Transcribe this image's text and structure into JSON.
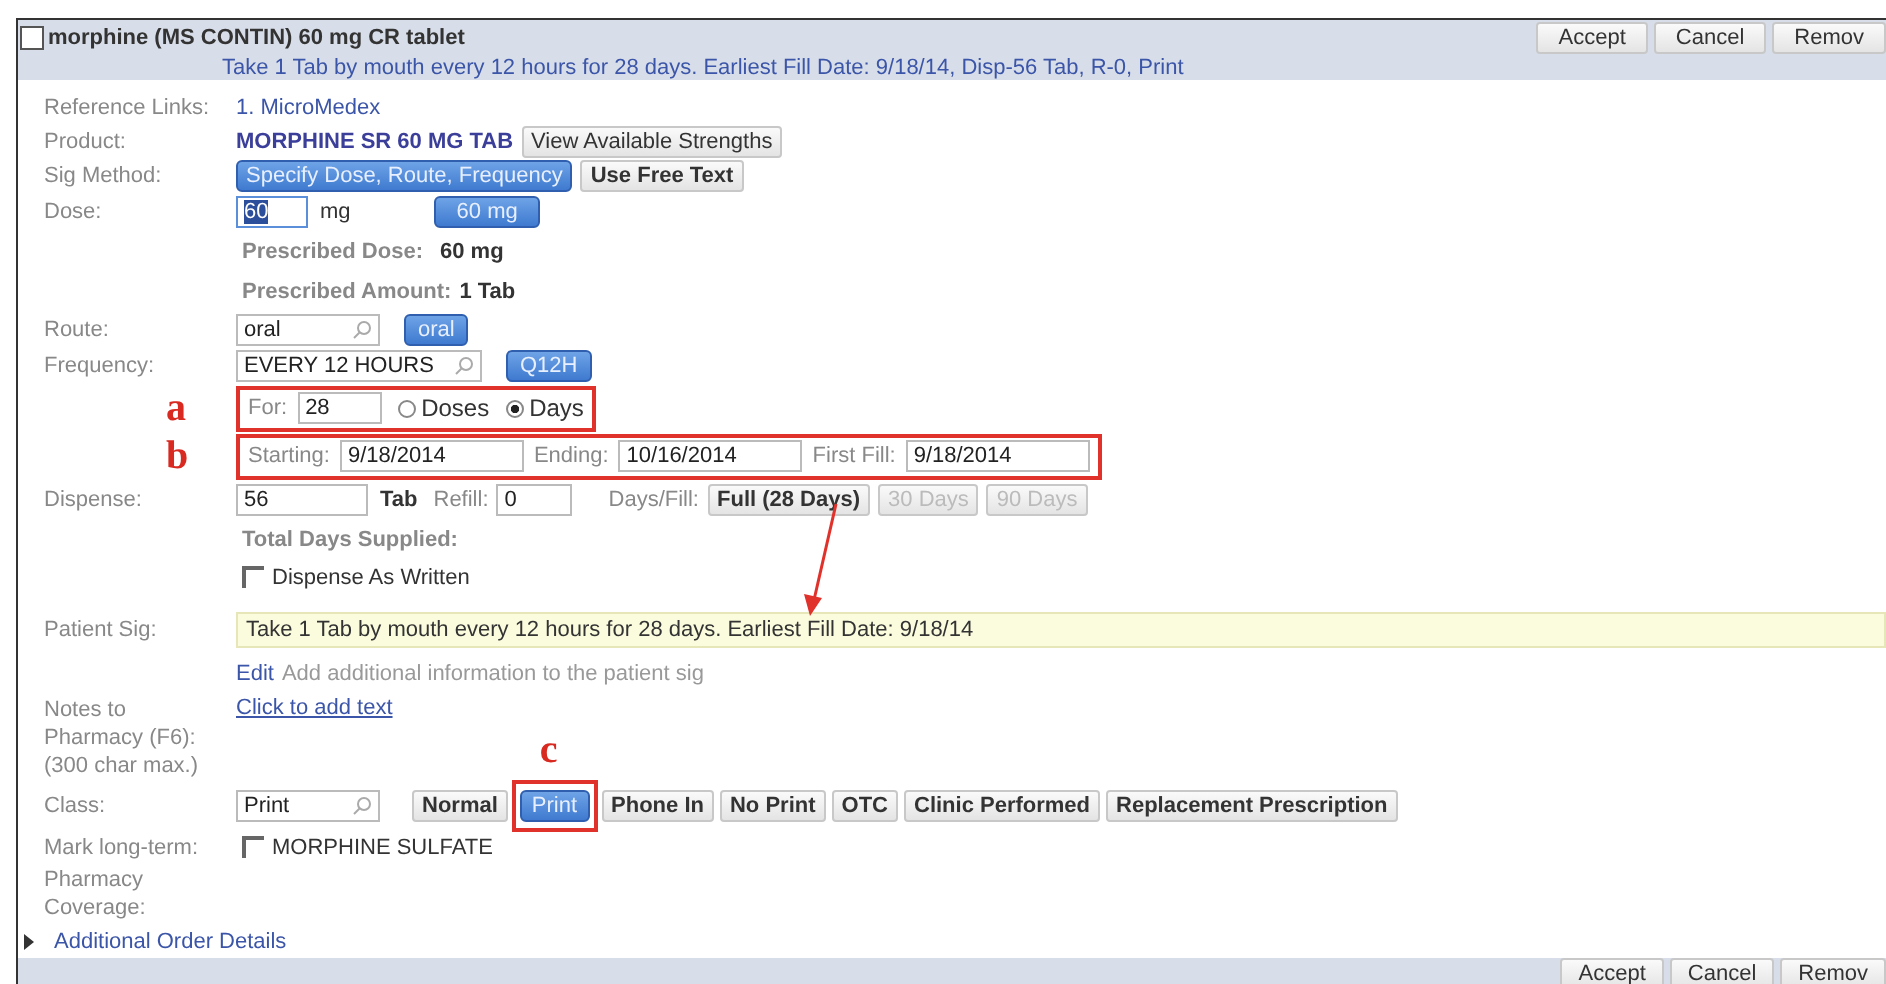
{
  "order": {
    "checked": false,
    "title": "morphine (MS CONTIN) 60 mg CR tablet",
    "summary": "Take 1 Tab by mouth every 12 hours for 28 days. Earliest Fill Date: 9/18/14, Disp-56 Tab, R-0, Print",
    "buttons": [
      "Accept",
      "Cancel",
      "Remov"
    ]
  },
  "reference_links": {
    "label": "Reference Links:",
    "link": "1. MicroMedex"
  },
  "product": {
    "label": "Product:",
    "name": "MORPHINE SR 60 MG TAB",
    "button": "View Available Strengths"
  },
  "sig_method": {
    "label": "Sig Method:",
    "options": [
      {
        "label": "Specify Dose, Route, Frequency",
        "selected": true
      },
      {
        "label": "Use Free Text",
        "selected": false
      }
    ]
  },
  "dose": {
    "label": "Dose:",
    "value": "60",
    "unit": "mg",
    "quick": "60 mg"
  },
  "prescribed": [
    {
      "label": "Prescribed Dose:",
      "value": "60 mg"
    },
    {
      "label": "Prescribed Amount:",
      "value": "1 Tab"
    }
  ],
  "route": {
    "label": "Route:",
    "value": "oral",
    "quick": "oral"
  },
  "frequency": {
    "label": "Frequency:",
    "value": "EVERY 12 HOURS",
    "quick": "Q12H"
  },
  "duration": {
    "annotation": "a",
    "label": "For:",
    "value": "28",
    "options": [
      {
        "label": "Doses",
        "selected": false
      },
      {
        "label": "Days",
        "selected": true
      }
    ]
  },
  "dates": {
    "annotation": "b",
    "fields": [
      {
        "label": "Starting:",
        "value": "9/18/2014"
      },
      {
        "label": "Ending:",
        "value": "10/16/2014"
      },
      {
        "label": "First Fill:",
        "value": "9/18/2014"
      }
    ]
  },
  "dispense": {
    "label": "Dispense:",
    "quantity": "56",
    "unit": "Tab",
    "refill_label": "Refill:",
    "refill": "0",
    "days_label": "Days/Fill:",
    "days_options": [
      {
        "label": "Full (28 Days)",
        "disabled": false
      },
      {
        "label": "30 Days",
        "disabled": true
      },
      {
        "label": "90 Days",
        "disabled": true
      }
    ],
    "total_label": "Total Days Supplied:"
  },
  "dispense_as_written": {
    "label": "Dispense As Written",
    "checked": false
  },
  "patient_sig": {
    "label": "Patient Sig:",
    "text": "Take 1 Tab by mouth every 12 hours for 28 days. Earliest Fill Date: 9/18/14",
    "edit": "Edit",
    "hint": "Add additional information to the patient sig"
  },
  "notes": {
    "label_lines": [
      "Notes to",
      "Pharmacy (F6):",
      "(300 char max.)"
    ],
    "link": "Click to add text"
  },
  "class": {
    "label": "Class:",
    "value": "Print",
    "options": [
      {
        "label": "Normal",
        "selected": false
      },
      {
        "label": "Print",
        "selected": true,
        "annotation": "c"
      },
      {
        "label": "Phone In",
        "selected": false
      },
      {
        "label": "No Print",
        "selected": false
      },
      {
        "label": "OTC",
        "selected": false
      },
      {
        "label": "Clinic Performed",
        "selected": false
      },
      {
        "label": "Replacement Prescription",
        "selected": false
      }
    ]
  },
  "long_term": {
    "label": "Mark long-term:",
    "option": "MORPHINE SULFATE",
    "checked": false
  },
  "coverage": {
    "label_lines": [
      "Pharmacy",
      "Coverage:"
    ]
  },
  "additional": {
    "label": "Additional Order Details",
    "expanded": false
  },
  "footer": {
    "buttons": [
      "Accept",
      "Cancel",
      "Remov"
    ]
  }
}
